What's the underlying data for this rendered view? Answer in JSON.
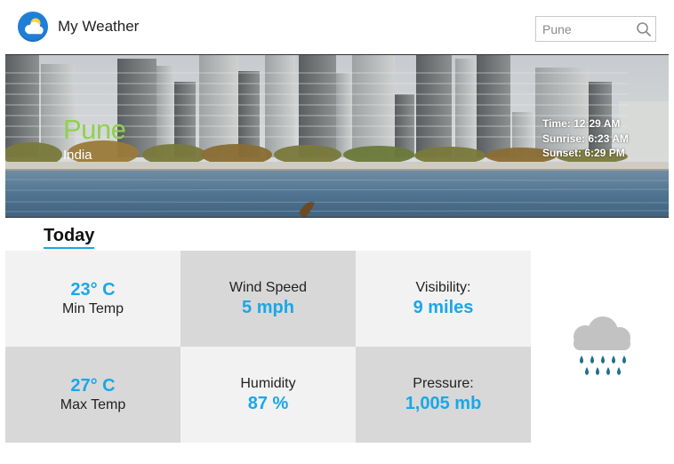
{
  "header": {
    "app_title": "My Weather",
    "logo_icon": "cloud-sun-icon",
    "search": {
      "placeholder": "Pune",
      "value": "",
      "icon": "search-icon"
    }
  },
  "location": {
    "city": "Pune",
    "country": "India",
    "time": "Time: 12:29 AM",
    "sunrise": "Sunrise: 6:23 AM",
    "sunset": "Sunset: 6:29 PM"
  },
  "today": {
    "heading": "Today",
    "min_temp": {
      "value": "23° C",
      "label": "Min Temp"
    },
    "wind_speed": {
      "label": "Wind Speed",
      "value": "5 mph"
    },
    "visibility": {
      "label": "Visibility:",
      "value": "9 miles"
    },
    "max_temp": {
      "value": "27° C",
      "label": "Max Temp"
    },
    "humidity": {
      "label": "Humidity",
      "value": "87 %"
    },
    "pressure": {
      "label": "Pressure:",
      "value": "1,005 mb"
    },
    "condition_icon": "rain-cloud-icon"
  },
  "colors": {
    "accent": "#1aa7e8",
    "city_green": "#8fd14f",
    "cell_light": "#f2f2f2",
    "cell_dark": "#d8d8d8",
    "rain_blue": "#1f6f8b"
  }
}
